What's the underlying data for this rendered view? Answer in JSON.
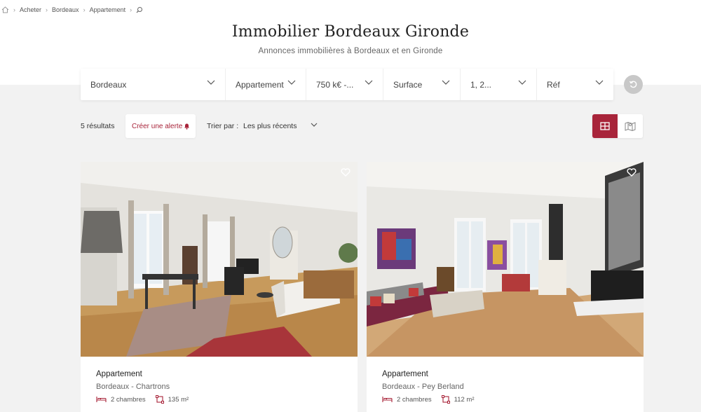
{
  "breadcrumb": {
    "home_icon": "home-icon",
    "items": [
      "Acheter",
      "Bordeaux",
      "Appartement"
    ],
    "search_icon": "search-icon"
  },
  "header": {
    "title": "Immobilier Bordeaux Gironde",
    "subtitle": "Annonces immobilières à Bordeaux et en Gironde"
  },
  "filters": [
    {
      "label": "Bordeaux"
    },
    {
      "label": "Appartement"
    },
    {
      "label": "750 k€ -..."
    },
    {
      "label": "Surface"
    },
    {
      "label": "1, 2..."
    },
    {
      "label": "Réf"
    }
  ],
  "toolbar": {
    "results": "5 résultats",
    "alert_label": "Créer une alerte",
    "sort_label": "Trier par :",
    "sort_value": "Les plus récents"
  },
  "colors": {
    "accent": "#a8243a",
    "background": "#f2f2f2"
  },
  "listings": [
    {
      "type": "Appartement",
      "location": "Bordeaux - Chartrons",
      "bedrooms": "2 chambres",
      "surface": "135 m²"
    },
    {
      "type": "Appartement",
      "location": "Bordeaux - Pey Berland",
      "bedrooms": "2 chambres",
      "surface": "112 m²"
    }
  ]
}
